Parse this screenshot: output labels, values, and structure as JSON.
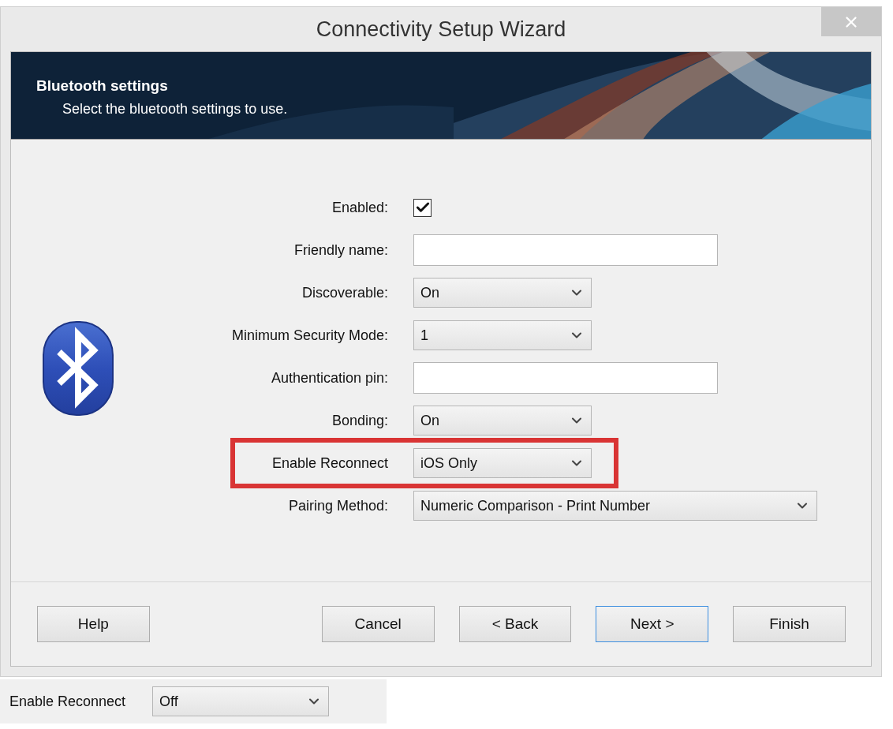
{
  "window": {
    "title": "Connectivity Setup Wizard"
  },
  "header": {
    "title": "Bluetooth settings",
    "subtitle": "Select the bluetooth settings to use."
  },
  "fields": [
    {
      "kind": "checkbox",
      "label": "Enabled:",
      "checked": true
    },
    {
      "kind": "text",
      "label": "Friendly name:"
    },
    {
      "kind": "select",
      "label": "Discoverable:",
      "value": "On",
      "wide": false
    },
    {
      "kind": "select",
      "label": "Minimum Security Mode:",
      "value": "1",
      "wide": false
    },
    {
      "kind": "text",
      "label": "Authentication pin:"
    },
    {
      "kind": "select",
      "label": "Bonding:",
      "value": "On",
      "wide": false
    },
    {
      "kind": "select",
      "label": "Enable Reconnect",
      "value": "iOS Only",
      "wide": false,
      "highlighted": true
    },
    {
      "kind": "select",
      "label": "Pairing Method:",
      "value": "Numeric Comparison - Print Number",
      "wide": true
    }
  ],
  "buttons": [
    {
      "label": "Help",
      "default": false
    },
    {
      "label": "Cancel",
      "default": false
    },
    {
      "label": "< Back",
      "default": false
    },
    {
      "label": "Next >",
      "default": true
    },
    {
      "label": "Finish",
      "default": false
    }
  ],
  "inset": {
    "label": "Enable Reconnect",
    "value": "Off"
  }
}
